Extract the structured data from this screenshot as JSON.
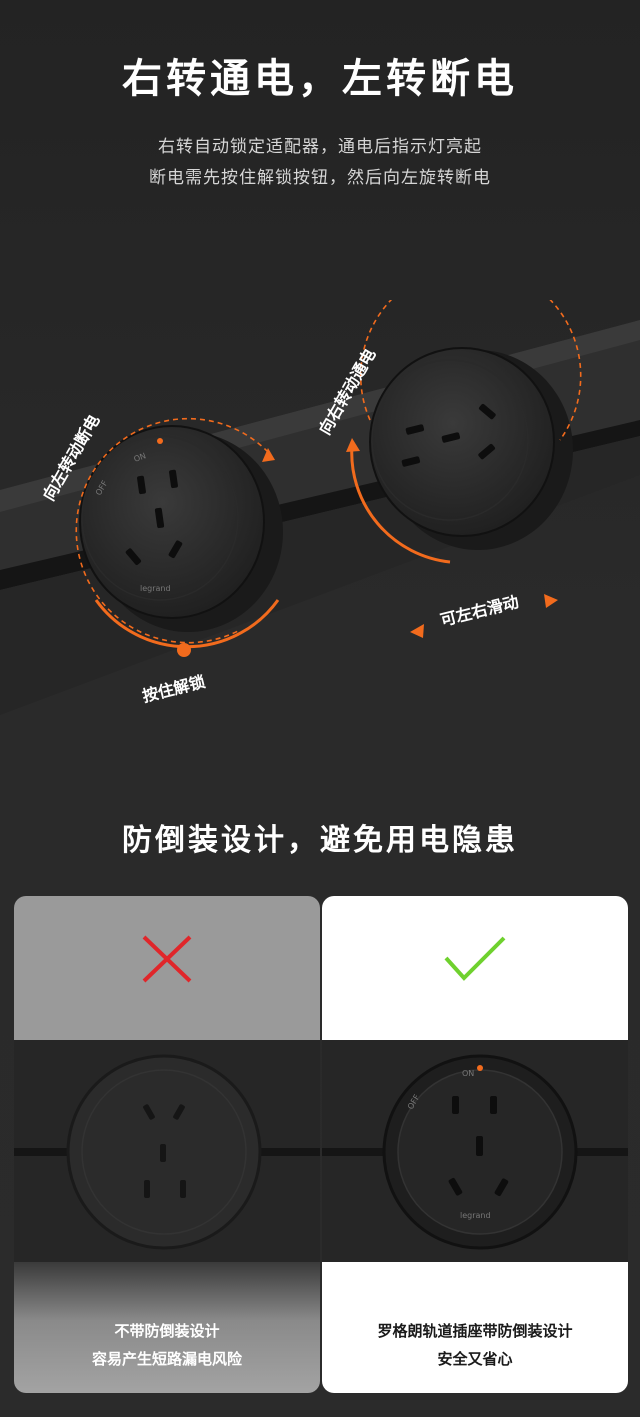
{
  "header": {
    "title": "右转通电，左转断电",
    "subtitle_line1": "右转自动锁定适配器，通电后指示灯亮起",
    "subtitle_line2": "断电需先按住解锁按钮，然后向左旋转断电"
  },
  "scene": {
    "label_left_turn": "向左转动断电",
    "label_right_turn": "向右转动通电",
    "label_unlock": "按住解锁",
    "label_slide": "可左右滑动",
    "socket_mark_off": "OFF",
    "socket_mark_on": "ON",
    "brand": "legrand"
  },
  "section2": {
    "title": "防倒装设计，避免用电隐患"
  },
  "compare": {
    "bad": {
      "line1": "不带防倒装设计",
      "line2": "容易产生短路漏电风险"
    },
    "good": {
      "line1": "罗格朗轨道插座带防倒装设计",
      "line2": "安全又省心"
    }
  },
  "colors": {
    "accent_orange": "#f26b1d",
    "cross_red": "#e0262a",
    "check_green": "#6fd12e"
  }
}
